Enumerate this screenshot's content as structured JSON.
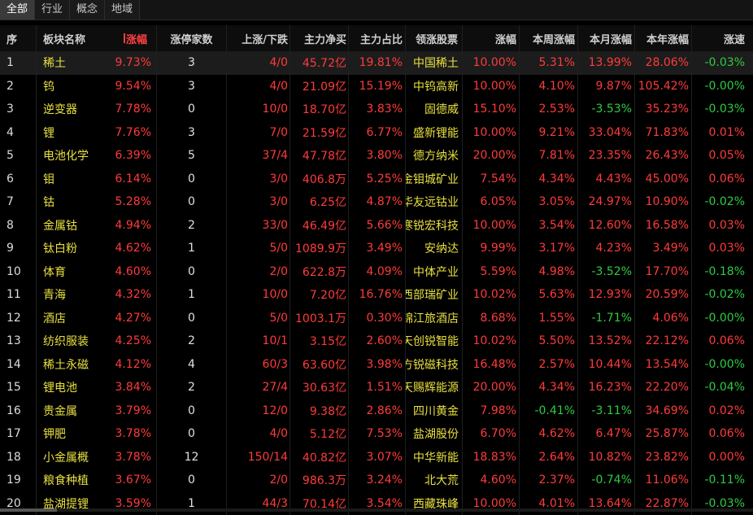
{
  "tabs": [
    "全部",
    "行业",
    "概念",
    "地域"
  ],
  "columns": {
    "idx": "序",
    "name": "板块名称",
    "change": "涨幅",
    "limit_up_count": "涨停家数",
    "up_down": "上涨/下跌",
    "main_net": "主力净买",
    "main_pct": "主力占比",
    "leader": "领涨股票",
    "leader_change": "涨幅",
    "week_change": "本周涨幅",
    "month_change": "本月涨幅",
    "year_change": "本年涨幅",
    "speed": "涨速"
  },
  "rows": [
    {
      "idx": "1",
      "name": "稀土",
      "change": "9.73%",
      "cnt": "3",
      "ud": "4/0",
      "net": "45.72亿",
      "pct": "19.81%",
      "leader": "中国稀土",
      "lchg": "10.00%",
      "week": "5.31%",
      "month": "13.99%",
      "year": "28.06%",
      "speed": "-0.03%"
    },
    {
      "idx": "2",
      "name": "钨",
      "change": "9.54%",
      "cnt": "3",
      "ud": "4/0",
      "net": "21.09亿",
      "pct": "15.19%",
      "leader": "中钨高新",
      "lchg": "10.00%",
      "week": "4.10%",
      "month": "9.87%",
      "year": "105.42%",
      "speed": "-0.00%"
    },
    {
      "idx": "3",
      "name": "逆变器",
      "change": "7.78%",
      "cnt": "0",
      "ud": "10/0",
      "net": "18.70亿",
      "pct": "3.83%",
      "leader": "固德威",
      "lchg": "15.10%",
      "week": "2.53%",
      "month": "-3.53%",
      "year": "35.23%",
      "speed": "-0.03%"
    },
    {
      "idx": "4",
      "name": "锂",
      "change": "7.76%",
      "cnt": "3",
      "ud": "7/0",
      "net": "21.59亿",
      "pct": "6.77%",
      "leader": "盛新锂能",
      "lchg": "10.00%",
      "week": "9.21%",
      "month": "33.04%",
      "year": "71.83%",
      "speed": "0.01%"
    },
    {
      "idx": "5",
      "name": "电池化学",
      "change": "6.39%",
      "cnt": "5",
      "ud": "37/4",
      "net": "47.78亿",
      "pct": "3.80%",
      "leader": "德方纳米",
      "lchg": "20.00%",
      "week": "7.81%",
      "month": "23.35%",
      "year": "26.43%",
      "speed": "0.05%"
    },
    {
      "idx": "6",
      "name": "钼",
      "change": "6.14%",
      "cnt": "0",
      "ud": "3/0",
      "net": "406.8万",
      "pct": "5.25%",
      "leader": "金钼城矿业",
      "lchg": "7.54%",
      "week": "4.34%",
      "month": "4.43%",
      "year": "45.00%",
      "speed": "0.06%"
    },
    {
      "idx": "7",
      "name": "钴",
      "change": "5.28%",
      "cnt": "0",
      "ud": "3/0",
      "net": "6.25亿",
      "pct": "4.87%",
      "leader": "华友远钴业",
      "lchg": "6.05%",
      "week": "3.05%",
      "month": "24.97%",
      "year": "10.90%",
      "speed": "-0.02%"
    },
    {
      "idx": "8",
      "name": "金属钴",
      "change": "4.94%",
      "cnt": "2",
      "ud": "33/0",
      "net": "46.49亿",
      "pct": "5.66%",
      "leader": "寒锐宏科技",
      "lchg": "10.00%",
      "week": "3.54%",
      "month": "12.60%",
      "year": "16.58%",
      "speed": "0.03%"
    },
    {
      "idx": "9",
      "name": "钛白粉",
      "change": "4.62%",
      "cnt": "1",
      "ud": "5/0",
      "net": "1089.9万",
      "pct": "3.49%",
      "leader": "安纳达",
      "lchg": "9.99%",
      "week": "3.17%",
      "month": "4.23%",
      "year": "3.49%",
      "speed": "0.03%"
    },
    {
      "idx": "10",
      "name": "体育",
      "change": "4.60%",
      "cnt": "0",
      "ud": "2/0",
      "net": "622.8万",
      "pct": "4.09%",
      "leader": "中体产业",
      "lchg": "5.59%",
      "week": "4.98%",
      "month": "-3.52%",
      "year": "17.70%",
      "speed": "-0.18%"
    },
    {
      "idx": "11",
      "name": "青海",
      "change": "4.32%",
      "cnt": "1",
      "ud": "10/0",
      "net": "7.20亿",
      "pct": "16.76%",
      "leader": "西部瑞矿业",
      "lchg": "10.02%",
      "week": "5.63%",
      "month": "12.93%",
      "year": "20.59%",
      "speed": "-0.02%"
    },
    {
      "idx": "12",
      "name": "酒店",
      "change": "4.27%",
      "cnt": "0",
      "ud": "5/0",
      "net": "1003.1万",
      "pct": "0.30%",
      "leader": "锦江旅酒店",
      "lchg": "8.68%",
      "week": "1.55%",
      "month": "-1.71%",
      "year": "4.06%",
      "speed": "-0.00%"
    },
    {
      "idx": "13",
      "name": "纺织服装",
      "change": "4.25%",
      "cnt": "2",
      "ud": "10/1",
      "net": "3.15亿",
      "pct": "2.60%",
      "leader": "天创锐智能",
      "lchg": "10.02%",
      "week": "5.50%",
      "month": "13.52%",
      "year": "22.12%",
      "speed": "0.06%"
    },
    {
      "idx": "14",
      "name": "稀土永磁",
      "change": "4.12%",
      "cnt": "4",
      "ud": "60/3",
      "net": "63.60亿",
      "pct": "3.98%",
      "leader": "北方锐磁科技",
      "lchg": "16.48%",
      "week": "2.57%",
      "month": "10.44%",
      "year": "13.54%",
      "speed": "-0.00%"
    },
    {
      "idx": "15",
      "name": "锂电池",
      "change": "3.84%",
      "cnt": "2",
      "ud": "27/4",
      "net": "30.63亿",
      "pct": "1.51%",
      "leader": "天赐辉能源",
      "lchg": "20.00%",
      "week": "4.34%",
      "month": "16.23%",
      "year": "22.20%",
      "speed": "-0.04%"
    },
    {
      "idx": "16",
      "name": "贵金属",
      "change": "3.79%",
      "cnt": "0",
      "ud": "12/0",
      "net": "9.38亿",
      "pct": "2.86%",
      "leader": "四川黄金",
      "lchg": "7.98%",
      "week": "-0.41%",
      "month": "-3.11%",
      "year": "34.69%",
      "speed": "0.02%"
    },
    {
      "idx": "17",
      "name": "钾肥",
      "change": "3.78%",
      "cnt": "0",
      "ud": "4/0",
      "net": "5.12亿",
      "pct": "7.53%",
      "leader": "盐湖股份",
      "lchg": "6.70%",
      "week": "4.62%",
      "month": "6.47%",
      "year": "25.87%",
      "speed": "0.06%"
    },
    {
      "idx": "18",
      "name": "小金属概",
      "change": "3.78%",
      "cnt": "12",
      "ud": "150/14",
      "net": "40.82亿",
      "pct": "3.07%",
      "leader": "中华新能",
      "lchg": "18.83%",
      "week": "2.64%",
      "month": "10.82%",
      "year": "23.82%",
      "speed": "0.00%"
    },
    {
      "idx": "19",
      "name": "粮食种植",
      "change": "3.67%",
      "cnt": "0",
      "ud": "2/0",
      "net": "986.3万",
      "pct": "3.24%",
      "leader": "北大荒",
      "lchg": "4.60%",
      "week": "2.37%",
      "month": "-0.74%",
      "year": "11.06%",
      "speed": "-0.11%"
    },
    {
      "idx": "20",
      "name": "盐湖提锂",
      "change": "3.59%",
      "cnt": "1",
      "ud": "44/3",
      "net": "70.14亿",
      "pct": "3.54%",
      "leader": "西藏珠峰",
      "lchg": "10.00%",
      "week": "4.01%",
      "month": "13.64%",
      "year": "22.87%",
      "speed": "-0.03%"
    }
  ],
  "colors": {
    "up": "#ff3b3b",
    "down": "#2ecc40",
    "name": "#e8e040",
    "background": "#000000"
  }
}
